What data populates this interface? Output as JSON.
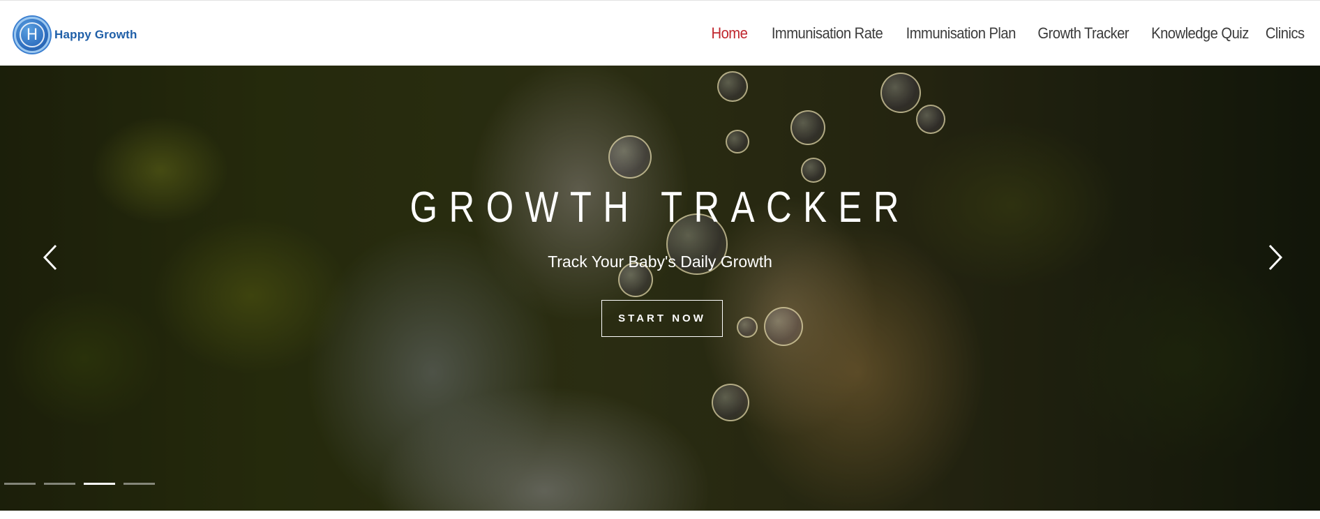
{
  "brand": {
    "logo_letter": "H",
    "name": "Happy Growth",
    "color": "#1f5fa8"
  },
  "nav": {
    "items": [
      {
        "label": "Home",
        "active": true
      },
      {
        "label": "Immunisation Rate",
        "active": false
      },
      {
        "label": "Immunisation Plan",
        "active": false
      },
      {
        "label": "Growth Tracker",
        "active": false
      },
      {
        "label": "Knowledge Quiz",
        "active": false
      },
      {
        "label": "Clinics",
        "active": false
      }
    ],
    "active_color": "#c0262d",
    "text_color": "#3b3b3b"
  },
  "hero": {
    "title": "GROWTH TRACKER",
    "subtitle": "Track Your Baby's Daily Growth",
    "button_label": "START NOW",
    "prev_icon": "chevron-left-icon",
    "next_icon": "chevron-right-icon",
    "slide_count": 4,
    "active_slide": 3
  }
}
